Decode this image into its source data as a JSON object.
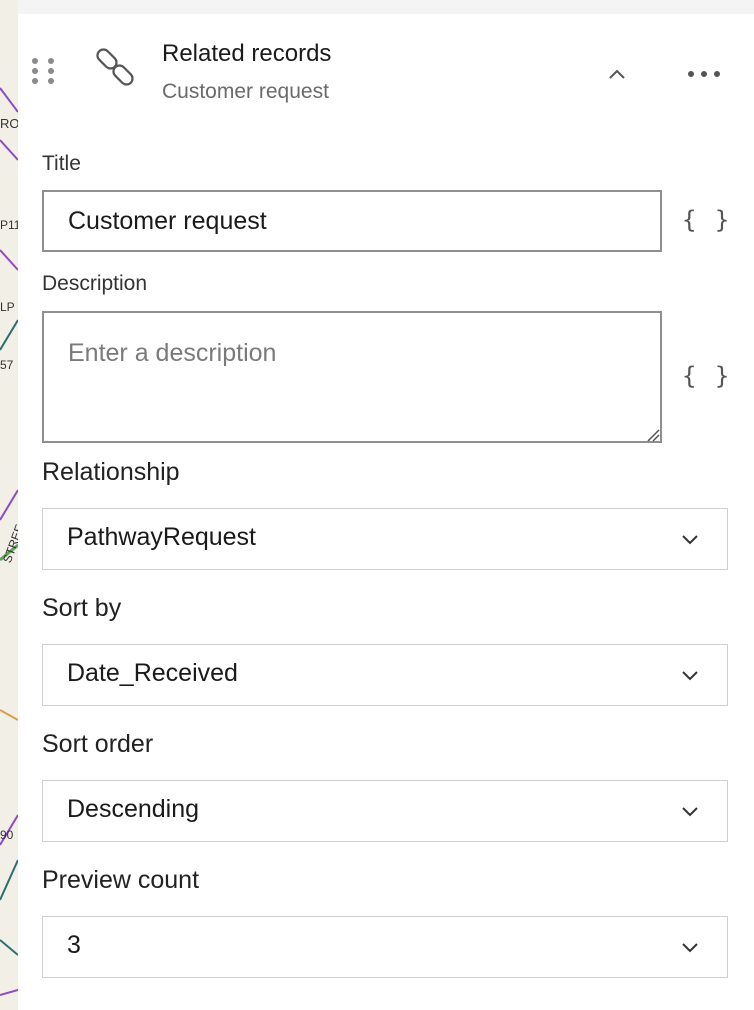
{
  "map": {
    "labels": [
      "RO",
      "P11",
      "LP",
      "57",
      "STREE",
      "90"
    ]
  },
  "header": {
    "title": "Related records",
    "subtitle": "Customer request",
    "icon": "link-icon",
    "collapse_icon": "chevron-up-icon",
    "more_icon": "more-horizontal-icon"
  },
  "form": {
    "title_label": "Title",
    "title_value": "Customer request",
    "description_label": "Description",
    "description_placeholder": "Enter a description",
    "expression_glyph": "{ }",
    "relationship_label": "Relationship",
    "relationship_value": "PathwayRequest",
    "sort_by_label": "Sort by",
    "sort_by_value": "Date_Received",
    "sort_order_label": "Sort order",
    "sort_order_value": "Descending",
    "preview_count_label": "Preview count",
    "preview_count_value": "3"
  }
}
